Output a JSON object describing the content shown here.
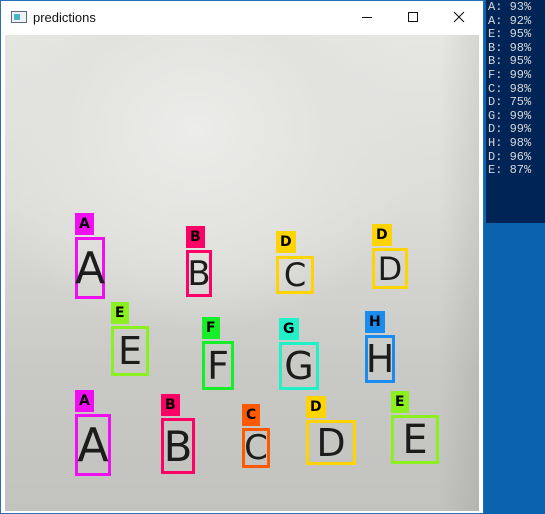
{
  "window": {
    "title": "predictions",
    "controls": {
      "minimize": "minimize-icon",
      "maximize": "maximize-icon",
      "close": "close-icon"
    }
  },
  "detections": [
    {
      "label": "A",
      "color": "#f00ff0"
    },
    {
      "label": "B",
      "color": "#ff0066"
    },
    {
      "label": "D",
      "color": "#ffd400"
    },
    {
      "label": "D",
      "color": "#ffd400"
    },
    {
      "label": "E",
      "color": "#8cf020"
    },
    {
      "label": "F",
      "color": "#17ee2a"
    },
    {
      "label": "G",
      "color": "#22f0c8"
    },
    {
      "label": "H",
      "color": "#1a8cf0"
    },
    {
      "label": "A",
      "color": "#f00ff0"
    },
    {
      "label": "B",
      "color": "#ff0066"
    },
    {
      "label": "C",
      "color": "#ff5a00"
    },
    {
      "label": "D",
      "color": "#ffd400"
    },
    {
      "label": "E",
      "color": "#8cf020"
    }
  ],
  "handwritten": [
    "A",
    "B",
    "C",
    "D",
    "E",
    "F",
    "G",
    "H",
    "A",
    "B",
    "C",
    "D",
    "E"
  ],
  "console": {
    "lines": [
      "A: 93%",
      "A: 92%",
      "E: 95%",
      "B: 98%",
      "B: 95%",
      "F: 99%",
      "C: 98%",
      "D: 75%",
      "G: 99%",
      "D: 99%",
      "H: 98%",
      "D: 96%",
      "E: 87%"
    ]
  }
}
